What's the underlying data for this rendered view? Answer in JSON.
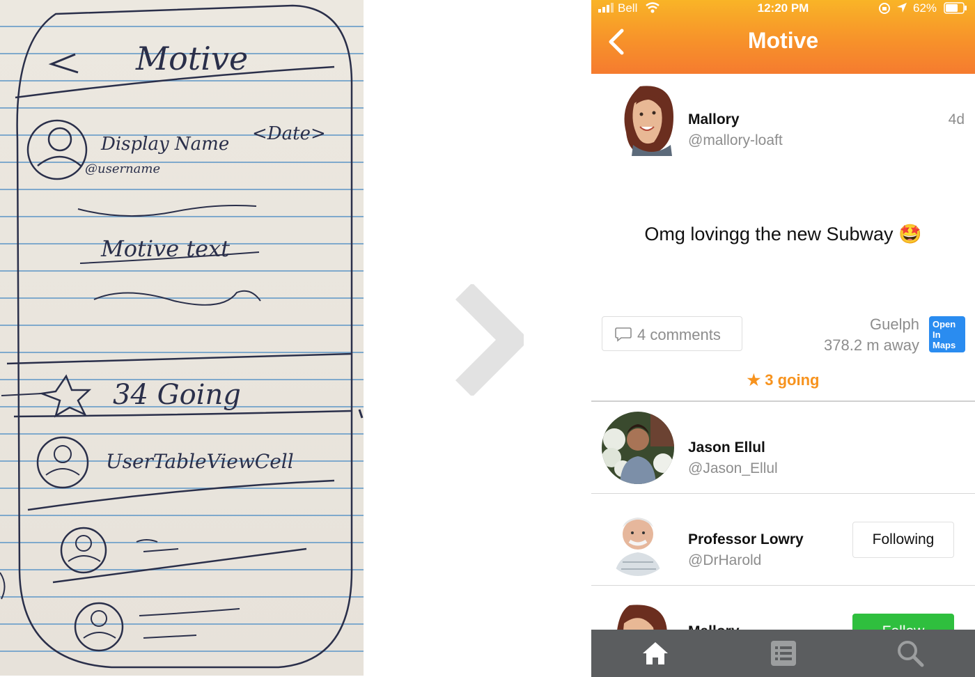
{
  "sketch": {
    "title": "Motive",
    "display_name": "Display Name",
    "date": "<Date>",
    "username": "@username",
    "motive_text": "Motive text",
    "going": "34 Going",
    "user_cell": "UserTableViewCell"
  },
  "status_bar": {
    "carrier": "Bell",
    "time": "12:20 PM",
    "battery": "62%"
  },
  "nav": {
    "title": "Motive",
    "back_icon": "chevron-left-icon"
  },
  "post": {
    "name": "Mallory",
    "handle": "@mallory-loaft",
    "date": "4d",
    "text": "Omg lovingg the new Subway 🤩",
    "comments": "4 comments",
    "location": "Guelph",
    "distance": "378.2 m away",
    "maps_button": "Open In Maps",
    "going": "3 going"
  },
  "users": [
    {
      "name": "Jason Ellul",
      "handle": "@Jason_Ellul",
      "button": ""
    },
    {
      "name": "Professor Lowry",
      "handle": "@DrHarold",
      "button": "Following"
    },
    {
      "name": "Mallory",
      "handle": "",
      "button": "Follow"
    }
  ],
  "tabbar": {
    "items": [
      "home-icon",
      "list-icon",
      "search-icon"
    ]
  },
  "colors": {
    "accent": "#f7931e",
    "follow": "#2fbf3e",
    "maps": "#2a8cf0",
    "tabbar": "#5b5d5f"
  }
}
